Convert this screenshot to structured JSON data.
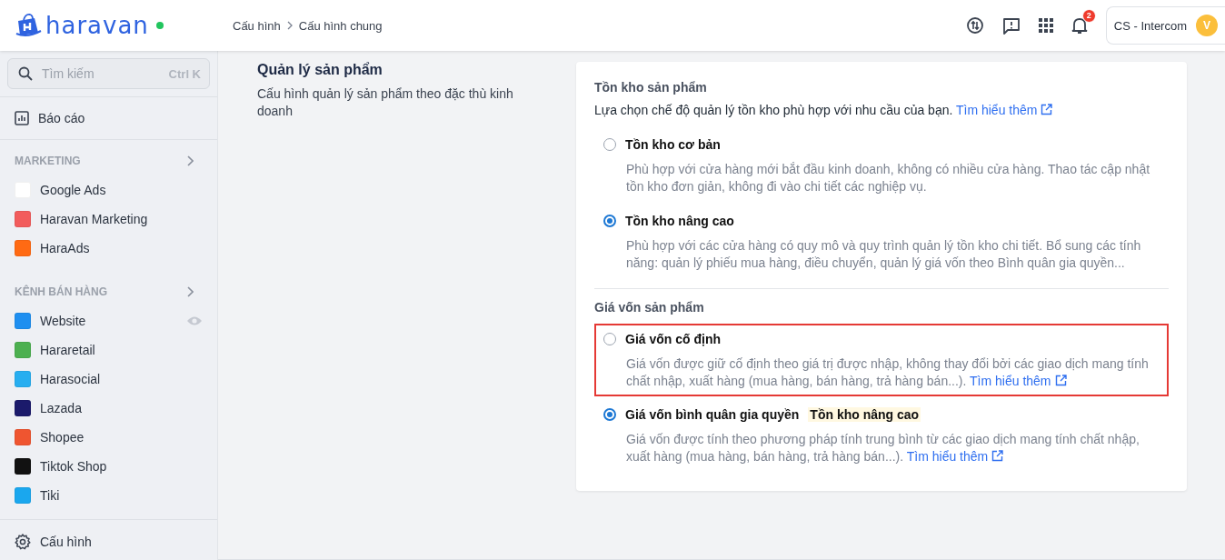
{
  "header": {
    "logo": "haravan",
    "online": true,
    "breadcrumb": [
      "Cấu hình",
      "Cấu hình chung"
    ],
    "notifications": "2",
    "account": "CS - Intercom",
    "avatar": "V"
  },
  "sidebar": {
    "search": {
      "placeholder": "Tìm kiếm",
      "shortcut": "Ctrl K"
    },
    "top": {
      "label": "Báo cáo"
    },
    "sections": [
      {
        "title": "MARKETING",
        "items": [
          {
            "label": "Google Ads",
            "color": "#ffffff",
            "preview": false
          },
          {
            "label": "Haravan Marketing",
            "color": "#f25c5c",
            "preview": false
          },
          {
            "label": "HaraAds",
            "color": "#ff6a13",
            "preview": false
          }
        ]
      },
      {
        "title": "KÊNH BÁN HÀNG",
        "items": [
          {
            "label": "Website",
            "color": "#1e8ff0",
            "preview": true
          },
          {
            "label": "Hararetail",
            "color": "#4cb050",
            "preview": false
          },
          {
            "label": "Harasocial",
            "color": "#27aef0",
            "preview": false
          },
          {
            "label": "Lazada",
            "color": "#1b1a6b",
            "preview": false
          },
          {
            "label": "Shopee",
            "color": "#ef5530",
            "preview": false
          },
          {
            "label": "Tiktok Shop",
            "color": "#111111",
            "preview": false
          },
          {
            "label": "Tiki",
            "color": "#1aa7ee",
            "preview": false
          }
        ]
      }
    ],
    "bottom": {
      "label": "Cấu hình"
    }
  },
  "section": {
    "title": "Quản lý sản phẩm",
    "description": "Cấu hình quản lý sản phẩm theo đặc thù kinh doanh"
  },
  "card": {
    "groups": [
      {
        "title": "Tồn kho sản phẩm",
        "intro": "Lựa chọn chế độ quản lý tồn kho phù hợp với nhu cầu của bạn.",
        "intro_link": "Tìm hiểu thêm",
        "options": [
          {
            "label": "Tồn kho cơ bản",
            "selected": false,
            "highlighted": false,
            "description": "Phù hợp với cửa hàng mới bắt đầu kinh doanh, không có nhiều cửa hàng. Thao tác cập nhật tồn kho đơn giản, không đi vào chi tiết các nghiệp vụ."
          },
          {
            "label": "Tồn kho nâng cao",
            "selected": true,
            "highlighted": false,
            "description": "Phù hợp với các cửa hàng có quy mô và quy trình quản lý tồn kho chi tiết. Bổ sung các tính năng: quản lý phiếu mua hàng, điều chuyển, quản lý giá vốn theo Bình quân gia quyền..."
          }
        ]
      },
      {
        "title": "Giá vốn sản phẩm",
        "options": [
          {
            "label": "Giá vốn cố định",
            "selected": false,
            "highlighted": true,
            "description": "Giá vốn được giữ cố định theo giá trị được nhập, không thay đổi bởi các giao dịch mang tính chất nhập, xuất hàng (mua hàng, bán hàng, trả hàng bán...).",
            "link": "Tìm hiểu thêm"
          },
          {
            "label": "Giá vốn bình quân gia quyền",
            "tag": "Tồn kho nâng cao",
            "selected": true,
            "highlighted": false,
            "description": "Giá vốn được tính theo phương pháp tính trung bình từ các giao dịch mang tính chất nhập, xuất hàng (mua hàng, bán hàng, trả hàng bán...).",
            "link": "Tìm hiểu thêm"
          }
        ]
      }
    ]
  }
}
